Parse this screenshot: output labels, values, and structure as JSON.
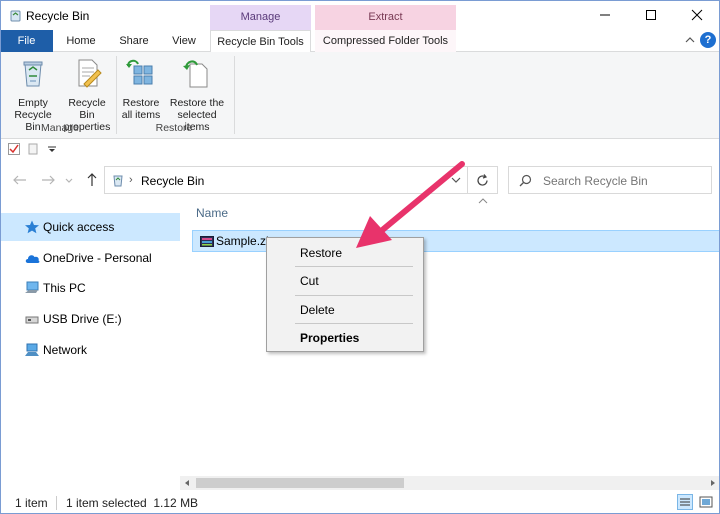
{
  "window": {
    "title": "Recycle Bin"
  },
  "ribbon": {
    "context_tabs": {
      "manage": "Manage",
      "extract": "Extract"
    },
    "tabs": {
      "file": "File",
      "home": "Home",
      "share": "Share",
      "view": "View",
      "recycle_bin_tools": "Recycle Bin Tools",
      "compressed_folder_tools": "Compressed Folder Tools"
    },
    "help": "?",
    "buttons": {
      "empty_line1": "Empty",
      "empty_line2": "Recycle Bin",
      "props_line1": "Recycle Bin",
      "props_line2": "properties",
      "restore_all_line1": "Restore",
      "restore_all_line2": "all items",
      "restore_sel_line1": "Restore the",
      "restore_sel_line2": "selected items"
    },
    "groups": {
      "manage": "Manage",
      "restore": "Restore"
    }
  },
  "address_bar": {
    "path": "Recycle Bin"
  },
  "search": {
    "placeholder": "Search Recycle Bin"
  },
  "nav_pane": {
    "items": [
      {
        "label": "Quick access",
        "icon": "star-icon"
      },
      {
        "label": "OneDrive - Personal",
        "icon": "cloud-icon"
      },
      {
        "label": "This PC",
        "icon": "computer-icon"
      },
      {
        "label": "USB Drive (E:)",
        "icon": "usb-drive-icon"
      },
      {
        "label": "Network",
        "icon": "network-icon"
      }
    ]
  },
  "file_list": {
    "column_name": "Name",
    "files": [
      {
        "name": "Sample.zi"
      }
    ]
  },
  "context_menu": {
    "items": [
      "Restore",
      "Cut",
      "Delete",
      "Properties"
    ]
  },
  "status_bar": {
    "item_count": "1 item",
    "selection": "1 item selected  1.12 MB"
  },
  "colors": {
    "accent": "#1e5ea8",
    "selection": "#cce8ff",
    "manage_tab": "#e6d7f5",
    "extract_tab": "#f7d3e2",
    "arrow": "#e8336b"
  }
}
